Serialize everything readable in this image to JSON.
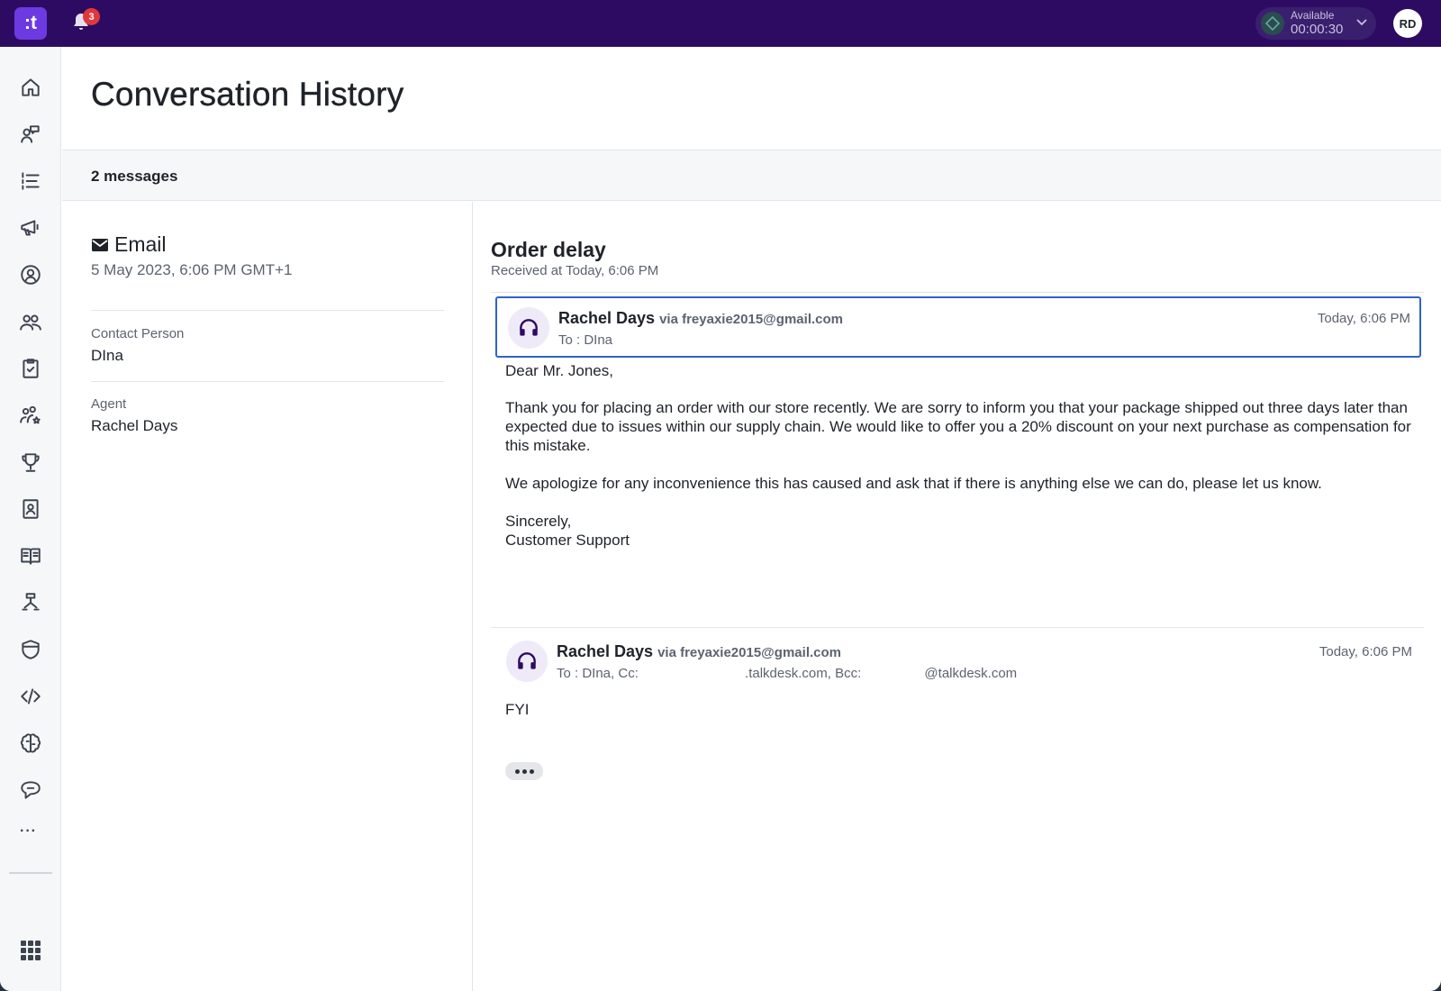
{
  "topbar": {
    "logo_text": ":t",
    "notification_count": "3",
    "status_label": "Available",
    "status_timer": "00:00:30",
    "user_initials": "RD"
  },
  "sidebar": {
    "items": [
      "home-icon",
      "conversations-icon",
      "queue-list-icon",
      "campaigns-icon",
      "contact-icon",
      "team-icon",
      "tasks-icon",
      "agents-icon",
      "trophy-icon",
      "contacts-book-icon",
      "knowledge-icon",
      "workflow-icon",
      "security-icon",
      "developer-icon",
      "ai-brain-icon",
      "chat-icon"
    ],
    "more_label": "···"
  },
  "page": {
    "title": "Conversation History",
    "message_count": "2 messages"
  },
  "info": {
    "channel": "Email",
    "date": "5 May 2023, 6:06 PM GMT+1",
    "contact_label": "Contact Person",
    "contact_value": "DIna",
    "agent_label": "Agent",
    "agent_value": "Rachel Days"
  },
  "conversation": {
    "subject": "Order delay",
    "received": "Received at Today, 6:06 PM",
    "messages": [
      {
        "sender": "Rachel Days",
        "via": "via freyaxie2015@gmail.com",
        "to": "To : DIna",
        "time": "Today, 6:06 PM",
        "body": [
          "Dear Mr. Jones,",
          "Thank you for placing an order with our store recently. We are sorry to inform you that your package shipped out three days later than expected due to issues within our supply chain. We would like to offer you a 20% discount on your next purchase as compensation for this mistake.",
          "We apologize for any inconvenience this has caused and ask that if there is anything else we can do, please let us know.",
          "Sincerely,",
          "Customer Support"
        ]
      },
      {
        "sender": "Rachel Days",
        "via": "via freyaxie2015@gmail.com",
        "to_prefix": "To : DIna, Cc: ",
        "to_cc_domain": ".talkdesk.com, Bcc: ",
        "to_bcc_domain": "@talkdesk.com",
        "time": "Today, 6:06 PM",
        "body": [
          "FYI"
        ]
      }
    ]
  }
}
